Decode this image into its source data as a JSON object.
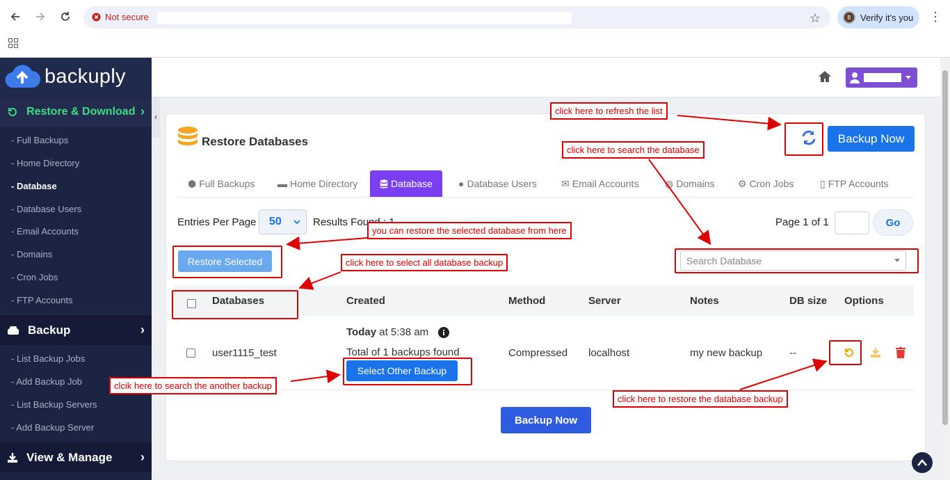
{
  "browser": {
    "security_label": "Not secure",
    "profile_initial": "B",
    "verify_label": "Verify it's you"
  },
  "sidebar": {
    "logo_text": "backuply",
    "sections": [
      {
        "label": "Restore & Download",
        "items": [
          "- Full Backups",
          "- Home Directory",
          "- Database",
          "- Database Users",
          "- Email Accounts",
          "- Domains",
          "- Cron Jobs",
          "- FTP Accounts"
        ]
      },
      {
        "label": "Backup",
        "items": [
          "- List Backup Jobs",
          "- Add Backup Job",
          "- List Backup Servers",
          "- Add Backup Server"
        ]
      },
      {
        "label": "View & Manage",
        "items": []
      }
    ],
    "active_item": "- Database"
  },
  "card": {
    "title": "Restore Databases",
    "backup_now_label": "Backup Now",
    "tabs": [
      {
        "label": "Full Backups",
        "icon": "cubes-icon"
      },
      {
        "label": "Home Directory",
        "icon": "folder-icon"
      },
      {
        "label": "Database",
        "icon": "database-icon",
        "active": true
      },
      {
        "label": "Database Users",
        "icon": "user-icon"
      },
      {
        "label": "Email Accounts",
        "icon": "envelope-icon"
      },
      {
        "label": "Domains",
        "icon": "globe-icon"
      },
      {
        "label": "Cron Jobs",
        "icon": "users-cog-icon"
      },
      {
        "label": "FTP Accounts",
        "icon": "file-icon"
      }
    ],
    "entries_label": "Entries Per Page",
    "entries_value": "50",
    "results_label": "Results Found : 1",
    "page_label": "Page 1 of 1",
    "go_label": "Go",
    "restore_selected_label": "Restore Selected",
    "search_placeholder": "Search Database",
    "columns": [
      "Databases",
      "Created",
      "Method",
      "Server",
      "Notes",
      "DB size",
      "Options"
    ],
    "row": {
      "database": "user1115_test",
      "created_day": "Today",
      "created_time": "at 5:38 am",
      "backups_found": "Total of 1 backups found",
      "select_other_label": "Select Other Backup",
      "method": "Compressed",
      "server": "localhost",
      "notes": "my new backup",
      "db_size": "--"
    },
    "bottom_backup_label": "Backup Now"
  },
  "annotations": {
    "refresh": "click here to refresh the list",
    "search": "click here to search the database",
    "restore_selected": "you can restore the selected database from here",
    "select_all": "click here to select all database backup",
    "other_backup": "clcik here to search the another backup",
    "restore_db": "click here to restore the database backup"
  },
  "colors": {
    "accent": "#7a3ff2",
    "primary": "#1a73e8",
    "annotation": "#dd0000",
    "sidebar": "#1c2444",
    "green": "#3ddc84"
  }
}
